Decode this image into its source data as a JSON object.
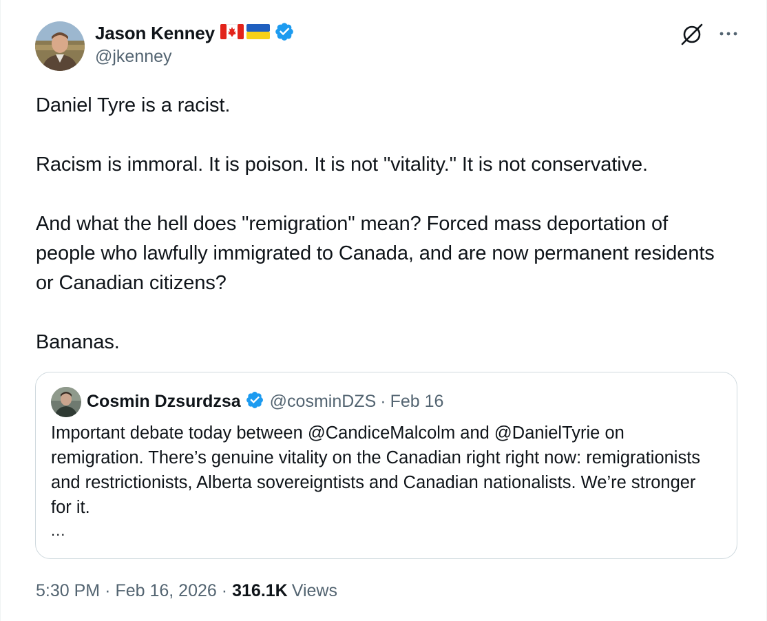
{
  "author": {
    "name": "Jason Kenney",
    "handle": "@jkenney",
    "flags": [
      "canada-flag-icon",
      "ukraine-flag-icon"
    ],
    "verified": true
  },
  "actions": {
    "grok_icon": "grok-icon",
    "more_icon": "more-icon"
  },
  "tweet": {
    "paragraphs": [
      "Daniel Tyre is a racist.",
      "Racism is immoral. It is poison. It is not \"vitality.\" It is not conservative.",
      "And what the hell does \"remigration\" mean? Forced mass deportation of people who lawfully immigrated to Canada, and are now permanent residents or Canadian citizens?",
      "Bananas."
    ]
  },
  "quote": {
    "name": "Cosmin Dzsurdzsa",
    "handle": "@cosminDZS",
    "separator": "·",
    "date": "Feb 16",
    "verified": true,
    "text": "Important debate today between @CandiceMalcolm and @DanielTyrie on remigration. There’s genuine vitality on the Canadian right right now: remigrationists and restrictionists, Alberta sovereigntists and Canadian nationalists. We’re stronger for it.",
    "truncation": "..."
  },
  "meta": {
    "time": "5:30 PM",
    "separator": "·",
    "date": "Feb 16, 2026",
    "views_count": "316.1K",
    "views_label": "Views"
  },
  "colors": {
    "text": "#0f1419",
    "secondary": "#536471",
    "verified": "#1d9bf0",
    "border": "#cfd9de"
  }
}
